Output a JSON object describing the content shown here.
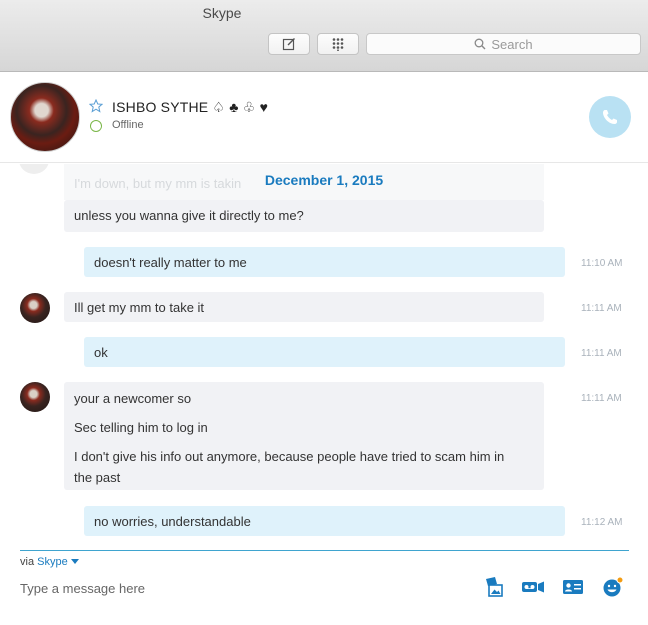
{
  "window": {
    "title": "Skype"
  },
  "toolbar": {
    "search_placeholder": "Search"
  },
  "contact": {
    "name": "ISHBO SYTHE ♤ ♣ ♧ ♥",
    "status": "Offline"
  },
  "chat": {
    "date": "December 1, 2015",
    "faded_text": "I'm down, but my mm is takin",
    "messages": [
      {
        "dir": "in",
        "lines": [
          "unless you wanna give it directly to me?"
        ],
        "time": ""
      },
      {
        "dir": "out",
        "lines": [
          "doesn't really matter to me"
        ],
        "time": "11:10 AM"
      },
      {
        "dir": "in",
        "lines": [
          "Ill get my mm to take it"
        ],
        "time": "11:11 AM"
      },
      {
        "dir": "out",
        "lines": [
          "ok"
        ],
        "time": "11:11 AM"
      },
      {
        "dir": "in",
        "lines": [
          "your a newcomer so",
          "Sec telling him to log in",
          "I don't give his info out anymore, because people have tried to scam him in the past"
        ],
        "time": "11:11 AM"
      },
      {
        "dir": "out",
        "lines": [
          "no worries, understandable"
        ],
        "time": "11:12 AM"
      }
    ]
  },
  "composer": {
    "via_label": "via",
    "via_link": "Skype",
    "placeholder": "Type a message here"
  },
  "colors": {
    "accent": "#1a7bbf",
    "call_button": "#b9e1f3",
    "status_offline": "#7ab648"
  },
  "icons": [
    "compose-icon",
    "dialpad-icon",
    "search-icon",
    "star-icon",
    "phone-icon",
    "send-image-icon",
    "video-message-icon",
    "contact-card-icon",
    "emoticon-icon"
  ]
}
